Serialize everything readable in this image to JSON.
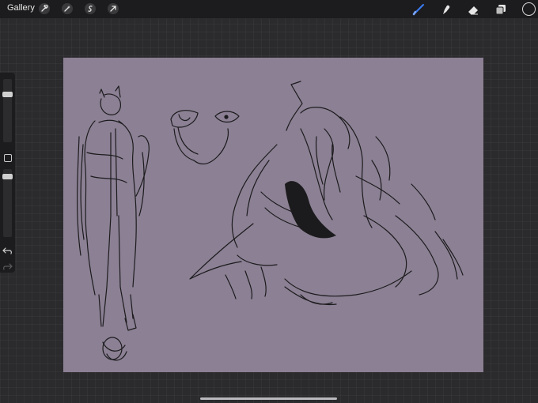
{
  "toolbar": {
    "gallery_label": "Gallery",
    "left_tools": [
      "wrench-icon",
      "magic-wand-icon",
      "selection-icon",
      "transform-arrow-icon"
    ],
    "right_tools": [
      "brush-icon",
      "smudge-icon",
      "eraser-icon",
      "layers-icon"
    ],
    "active_tool": "brush-icon",
    "accent_color": "#3b7bf2",
    "current_color": "#1c1c1e"
  },
  "sidebar": {
    "brush_size_slider": "size-slider",
    "opacity_slider": "opacity-slider",
    "modify_button": "square-icon",
    "undo": "undo-arrow-icon",
    "redo": "redo-arrow-icon"
  },
  "canvas": {
    "background_color": "#8c8094",
    "content": "sketch-drawing"
  }
}
